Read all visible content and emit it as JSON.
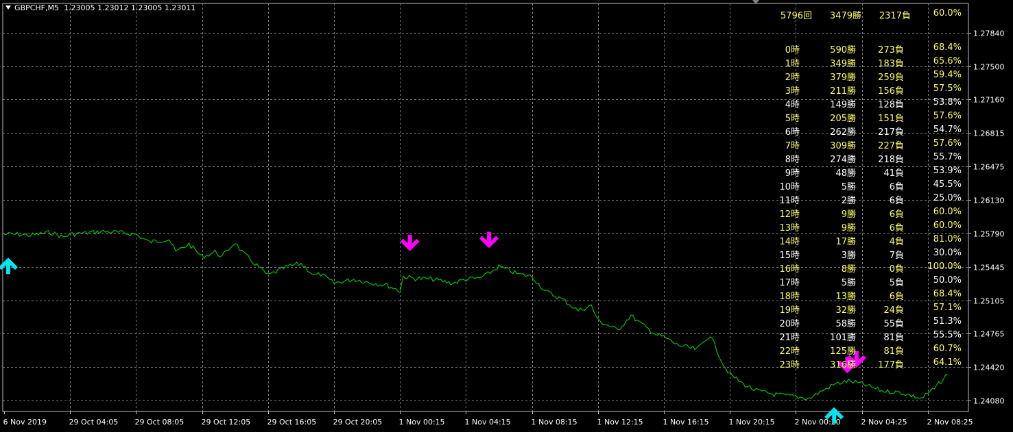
{
  "header": {
    "symbol_timeframe": "GBPCHF,M5",
    "ohlc": "1.23005 1.23012 1.23005 1.23011"
  },
  "colors": {
    "background": "#000000",
    "grid": "#808080",
    "price_line": "#00c000",
    "axis_text": "#ffffff",
    "buy_arrow": "#00e5ee",
    "sell_arrow": "#ff00ff",
    "stats_yellow": "#ffff66",
    "stats_white": "#ffffff"
  },
  "chart_data": {
    "type": "line",
    "title": "",
    "xlabel": "",
    "ylabel": "",
    "ylim": [
      1.2394,
      1.2795
    ],
    "y_ticks": [
      "1.27840",
      "1.27500",
      "1.27160",
      "1.26815",
      "1.26475",
      "1.26130",
      "1.25790",
      "1.25445",
      "1.25105",
      "1.24765",
      "1.24420",
      "1.24080"
    ],
    "y_tick_values": [
      1.2784,
      1.275,
      1.2716,
      1.26815,
      1.26475,
      1.2613,
      1.2579,
      1.25445,
      1.25105,
      1.24765,
      1.2442,
      1.2408
    ],
    "x_ticks": [
      "6 Nov 2019",
      "29 Oct 04:05",
      "29 Oct 08:05",
      "29 Oct 12:05",
      "29 Oct 16:05",
      "29 Oct 20:05",
      "1 Nov 00:15",
      "1 Nov 04:15",
      "1 Nov 08:15",
      "1 Nov 12:15",
      "1 Nov 16:15",
      "1 Nov 20:15",
      "2 Nov 00:20",
      "2 Nov 04:25",
      "2 Nov 08:25"
    ],
    "grid": true,
    "series": [
      {
        "x_index": [
          0,
          0.2,
          0.4,
          0.7,
          0.9,
          1.0,
          1.2,
          1.5,
          1.7,
          2.0,
          2.2,
          2.5,
          2.6,
          2.8,
          3.0,
          3.2,
          3.3,
          3.5,
          3.6,
          3.8,
          4.0,
          4.3,
          4.5,
          4.7,
          4.8,
          5.0,
          5.3,
          5.6,
          5.8,
          6.0,
          6.05,
          6.2,
          6.5,
          6.8,
          7.0,
          7.2,
          7.3,
          7.5,
          7.8,
          8.0,
          8.2,
          8.5,
          8.7,
          8.9,
          9.0,
          9.3,
          9.5,
          9.7,
          9.9,
          10.0,
          10.2,
          10.5,
          10.7,
          10.9,
          11.0,
          11.2,
          11.4,
          11.7,
          12.0,
          12.2,
          12.4,
          12.6,
          12.8,
          13.0,
          13.3,
          13.6,
          13.9,
          14.1,
          14.3
        ],
        "values": [
          1.2578,
          1.2578,
          1.2577,
          1.258,
          1.2575,
          1.2578,
          1.2579,
          1.2581,
          1.258,
          1.2578,
          1.257,
          1.2573,
          1.256,
          1.2568,
          1.2555,
          1.256,
          1.2555,
          1.257,
          1.256,
          1.2548,
          1.2536,
          1.2545,
          1.2548,
          1.2536,
          1.2537,
          1.2528,
          1.2532,
          1.2528,
          1.2526,
          1.252,
          1.2535,
          1.2533,
          1.2532,
          1.2528,
          1.2532,
          1.2533,
          1.2536,
          1.2545,
          1.2537,
          1.2535,
          1.252,
          1.251,
          1.25,
          1.2505,
          1.249,
          1.248,
          1.2495,
          1.2484,
          1.2475,
          1.2473,
          1.2465,
          1.246,
          1.2475,
          1.2445,
          1.2435,
          1.2425,
          1.2418,
          1.2414,
          1.2412,
          1.241,
          1.2418,
          1.2425,
          1.2428,
          1.2425,
          1.2418,
          1.2416,
          1.241,
          1.242,
          1.2435
        ]
      }
    ],
    "signals": [
      {
        "kind": "buy",
        "x_index": 0.0,
        "price": 1.255
      },
      {
        "kind": "sell",
        "x_index": 6.15,
        "price": 1.2565
      },
      {
        "kind": "sell",
        "x_index": 7.35,
        "price": 1.2568
      },
      {
        "kind": "sell",
        "x_index": 12.78,
        "price": 1.244
      },
      {
        "kind": "sell",
        "x_index": 12.92,
        "price": 1.2446
      },
      {
        "kind": "buy",
        "x_index": 12.58,
        "price": 1.2397
      }
    ]
  },
  "stats": {
    "summary": {
      "count": "5796回",
      "wins": "3479勝",
      "losses": "2317負",
      "rate": "60.0%"
    },
    "rows": [
      {
        "hour": "0時",
        "wins": "590勝",
        "losses": "273負",
        "rate": "68.4%",
        "highlight": true
      },
      {
        "hour": "1時",
        "wins": "349勝",
        "losses": "183負",
        "rate": "65.6%",
        "highlight": true
      },
      {
        "hour": "2時",
        "wins": "379勝",
        "losses": "259負",
        "rate": "59.4%",
        "highlight": true
      },
      {
        "hour": "3時",
        "wins": "211勝",
        "losses": "156負",
        "rate": "57.5%",
        "highlight": true
      },
      {
        "hour": "4時",
        "wins": "149勝",
        "losses": "128負",
        "rate": "53.8%",
        "highlight": false
      },
      {
        "hour": "5時",
        "wins": "205勝",
        "losses": "151負",
        "rate": "57.6%",
        "highlight": true
      },
      {
        "hour": "6時",
        "wins": "262勝",
        "losses": "217負",
        "rate": "54.7%",
        "highlight": false
      },
      {
        "hour": "7時",
        "wins": "309勝",
        "losses": "227負",
        "rate": "57.6%",
        "highlight": true
      },
      {
        "hour": "8時",
        "wins": "274勝",
        "losses": "218負",
        "rate": "55.7%",
        "highlight": false
      },
      {
        "hour": "9時",
        "wins": "48勝",
        "losses": "41負",
        "rate": "53.9%",
        "highlight": false
      },
      {
        "hour": "10時",
        "wins": "5勝",
        "losses": "6負",
        "rate": "45.5%",
        "highlight": false
      },
      {
        "hour": "11時",
        "wins": "2勝",
        "losses": "6負",
        "rate": "25.0%",
        "highlight": false
      },
      {
        "hour": "12時",
        "wins": "9勝",
        "losses": "6負",
        "rate": "60.0%",
        "highlight": true
      },
      {
        "hour": "13時",
        "wins": "9勝",
        "losses": "6負",
        "rate": "60.0%",
        "highlight": true
      },
      {
        "hour": "14時",
        "wins": "17勝",
        "losses": "4負",
        "rate": "81.0%",
        "highlight": true
      },
      {
        "hour": "15時",
        "wins": "3勝",
        "losses": "7負",
        "rate": "30.0%",
        "highlight": false
      },
      {
        "hour": "16時",
        "wins": "8勝",
        "losses": "0負",
        "rate": "100.0%",
        "highlight": true
      },
      {
        "hour": "17時",
        "wins": "5勝",
        "losses": "5負",
        "rate": "50.0%",
        "highlight": false
      },
      {
        "hour": "18時",
        "wins": "13勝",
        "losses": "6負",
        "rate": "68.4%",
        "highlight": true
      },
      {
        "hour": "19時",
        "wins": "32勝",
        "losses": "24負",
        "rate": "57.1%",
        "highlight": true
      },
      {
        "hour": "20時",
        "wins": "58勝",
        "losses": "55負",
        "rate": "51.3%",
        "highlight": false
      },
      {
        "hour": "21時",
        "wins": "101勝",
        "losses": "81負",
        "rate": "55.5%",
        "highlight": false
      },
      {
        "hour": "22時",
        "wins": "125勝",
        "losses": "81負",
        "rate": "60.7%",
        "highlight": true
      },
      {
        "hour": "23時",
        "wins": "316勝",
        "losses": "177負",
        "rate": "64.1%",
        "highlight": true
      }
    ]
  }
}
